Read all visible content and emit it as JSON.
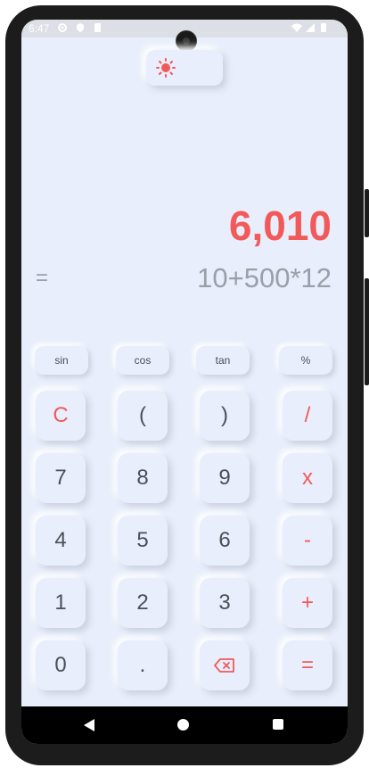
{
  "status_bar": {
    "time": "6:47",
    "icons": [
      "settings-icon",
      "shield-icon",
      "sd-card-icon",
      "wifi-icon",
      "signal-icon",
      "battery-icon"
    ]
  },
  "theme_toggle": {
    "light_icon": "sun-icon",
    "dark_icon": "moon-icon",
    "active": "light"
  },
  "display": {
    "result": "6,010",
    "equals": "=",
    "expression": "10+500*12"
  },
  "function_keys": [
    "sin",
    "cos",
    "tan",
    "%"
  ],
  "keys": {
    "row1": [
      "C",
      "(",
      ")",
      "/"
    ],
    "row2": [
      "7",
      "8",
      "9",
      "x"
    ],
    "row3": [
      "4",
      "5",
      "6",
      "-"
    ],
    "row4": [
      "1",
      "2",
      "3",
      "+"
    ],
    "row5": [
      "0",
      ".",
      "backspace-icon",
      "="
    ]
  },
  "colors": {
    "accent": "#f25a5a",
    "background": "#e8eefb",
    "text": "#4a4f58",
    "muted": "#9aa0a8"
  },
  "nav_bar": [
    "back-icon",
    "home-icon",
    "recents-icon"
  ]
}
